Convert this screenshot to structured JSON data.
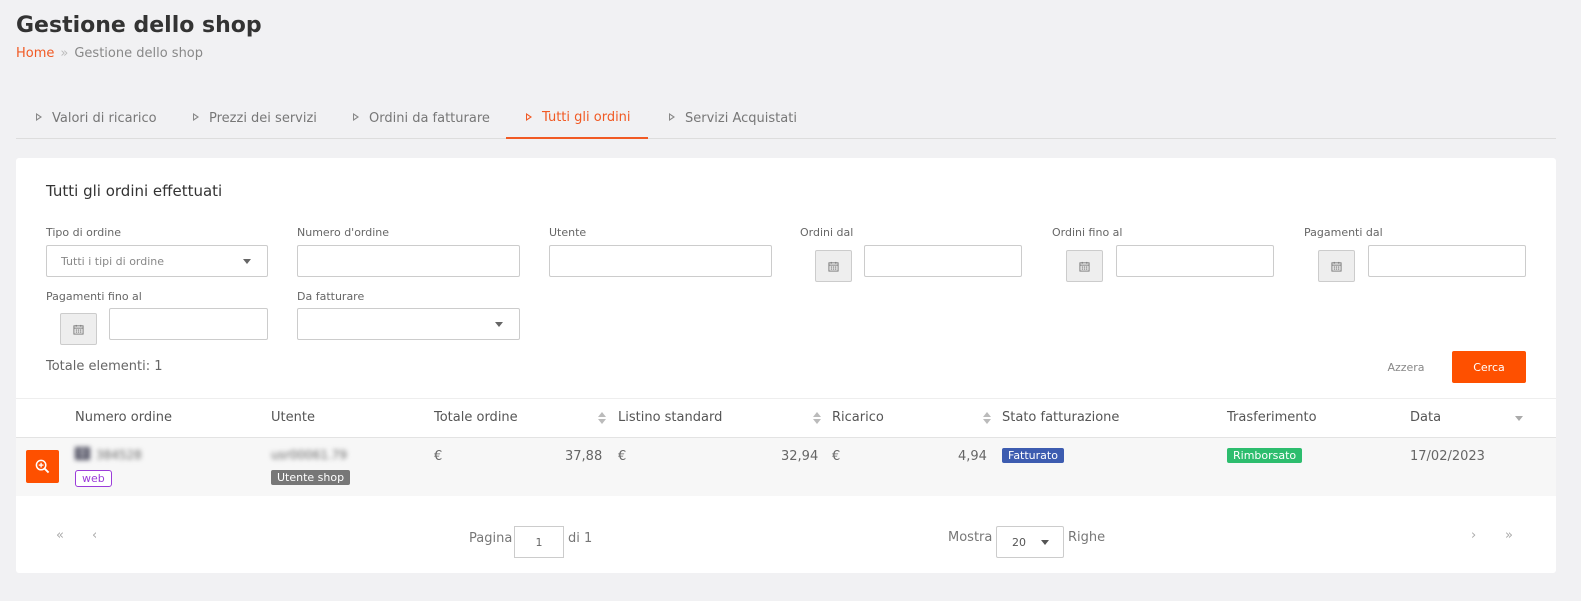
{
  "page": {
    "title": "Gestione dello shop"
  },
  "breadcrumb": {
    "home": "Home",
    "separator": "»",
    "current": "Gestione dello shop"
  },
  "tabs": [
    {
      "label": "Valori di ricarico"
    },
    {
      "label": "Prezzi dei servizi"
    },
    {
      "label": "Ordini da fatturare"
    },
    {
      "label": "Tutti gli ordini",
      "active": true
    },
    {
      "label": "Servizi Acquistati"
    }
  ],
  "filters": {
    "title": "Tutti gli ordini effettuati",
    "order_type": {
      "label": "Tipo di ordine",
      "value": "Tutti i tipi di ordine"
    },
    "order_number": {
      "label": "Numero d'ordine",
      "value": ""
    },
    "user": {
      "label": "Utente",
      "value": ""
    },
    "orders_from": {
      "label": "Ordini dal",
      "value": ""
    },
    "orders_to": {
      "label": "Ordini fino al",
      "value": ""
    },
    "payments_from": {
      "label": "Pagamenti dal",
      "value": ""
    },
    "payments_to": {
      "label": "Pagamenti fino al",
      "value": ""
    },
    "to_invoice": {
      "label": "Da fatturare",
      "value": ""
    },
    "total_label": "Totale elementi: 1",
    "reset_label": "Azzera",
    "search_label": "Cerca"
  },
  "table": {
    "headers": {
      "order_number": "Numero ordine",
      "user": "Utente",
      "order_total": "Totale ordine",
      "standard_list": "Listino standard",
      "markup": "Ricarico",
      "billing_status": "Stato fatturazione",
      "transfer": "Trasferimento",
      "date": "Data"
    },
    "rows": [
      {
        "order_prefix": "0",
        "order_number": "384528",
        "channel": "web",
        "user": "usr00061.79",
        "user_type": "Utente shop",
        "currency": "€",
        "order_total": "37,88",
        "standard_list": "32,94",
        "markup": "4,94",
        "billing_status": "Fatturato",
        "transfer": "Rimborsato",
        "date": "17/02/2023"
      }
    ]
  },
  "pagination": {
    "first": "«",
    "prev": "‹",
    "page_label": "Pagina",
    "page_value": "1",
    "of_label": "di 1",
    "show_label": "Mostra",
    "rows_value": "20",
    "rows_label": "Righe",
    "next": "›",
    "last": "»"
  },
  "colors": {
    "accent": "#f15a24",
    "primary_button": "#fe5000",
    "billed_badge": "#3d5cb0",
    "refunded_badge": "#2dbd6e",
    "web_badge": "#9b3cd9"
  }
}
